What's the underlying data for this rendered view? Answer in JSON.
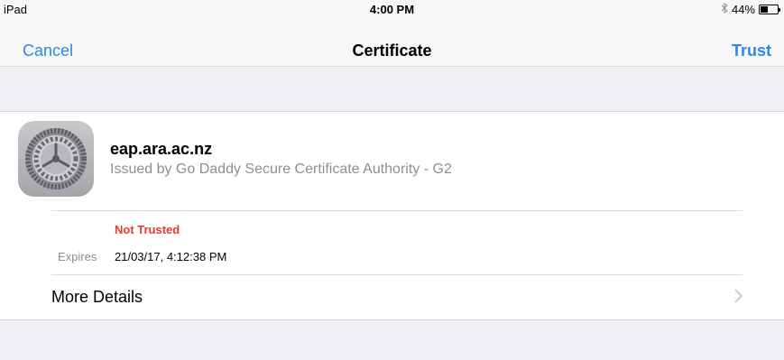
{
  "status_bar": {
    "device": "iPad",
    "time": "4:00 PM",
    "battery_percent": "44%",
    "battery_level": 0.44,
    "bluetooth_icon": "bluetooth-icon"
  },
  "nav": {
    "cancel_label": "Cancel",
    "title": "Certificate",
    "trust_label": "Trust",
    "accent_color": "#2f87e6"
  },
  "certificate": {
    "icon": "settings-gear-icon",
    "host": "eap.ara.ac.nz",
    "issuer": "Issued by Go Daddy Secure Certificate Authority - G2",
    "status": "Not Trusted",
    "status_color": "#e63a2d",
    "expires_label": "Expires",
    "expires_value": "21/03/17, 4:12:38 PM"
  },
  "more_details": {
    "label": "More Details",
    "icon": "chevron-right-icon"
  }
}
